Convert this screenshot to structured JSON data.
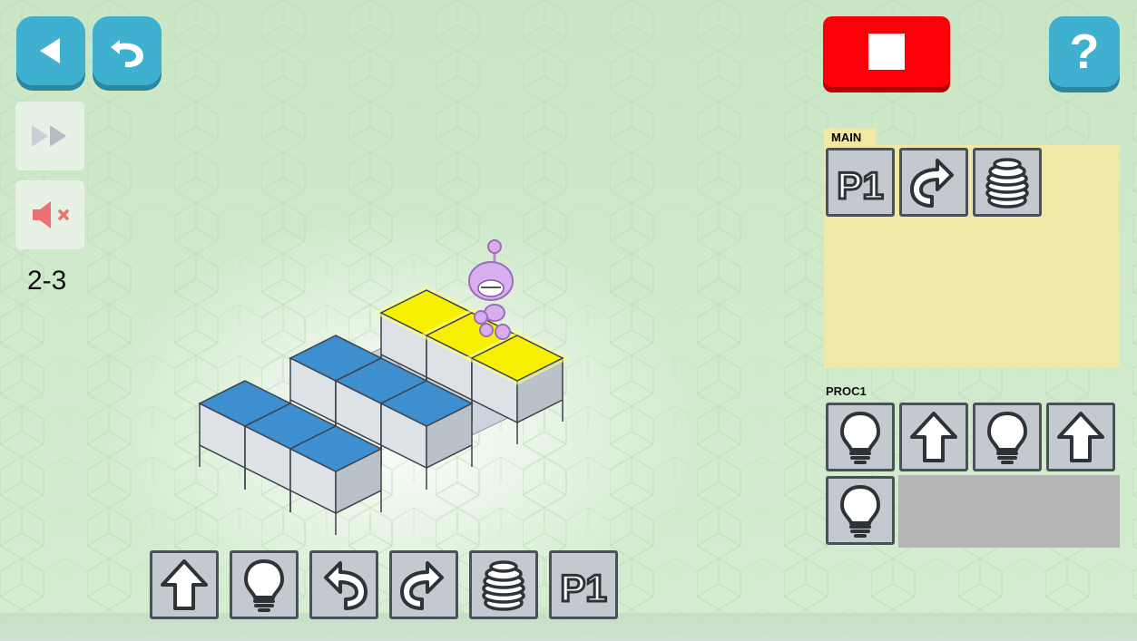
{
  "level": {
    "label": "2-3"
  },
  "main": {
    "label": "MAIN",
    "commands": [
      "p1",
      "turn-right",
      "spring"
    ]
  },
  "proc1": {
    "label": "PROC1",
    "commands": [
      "light",
      "forward",
      "light",
      "forward",
      "light"
    ]
  },
  "toolbar": {
    "commands": [
      "forward",
      "light",
      "turn-left",
      "turn-right",
      "spring",
      "p1"
    ]
  },
  "icons": {
    "back": "back-arrow-icon",
    "undo": "undo-icon",
    "fast_forward": "fast-forward-icon",
    "sound": "sound-muted-icon",
    "stop": "stop-icon",
    "help": "help-icon"
  },
  "help": {
    "label": "?"
  },
  "colors": {
    "accent_blue": "#3fb0d0",
    "stop_red": "#fb0008",
    "tile_blue": "#3d8fd0",
    "tile_yellow": "#f7f000",
    "main_panel": "#efe8a6",
    "robot": "#d9aef0"
  }
}
